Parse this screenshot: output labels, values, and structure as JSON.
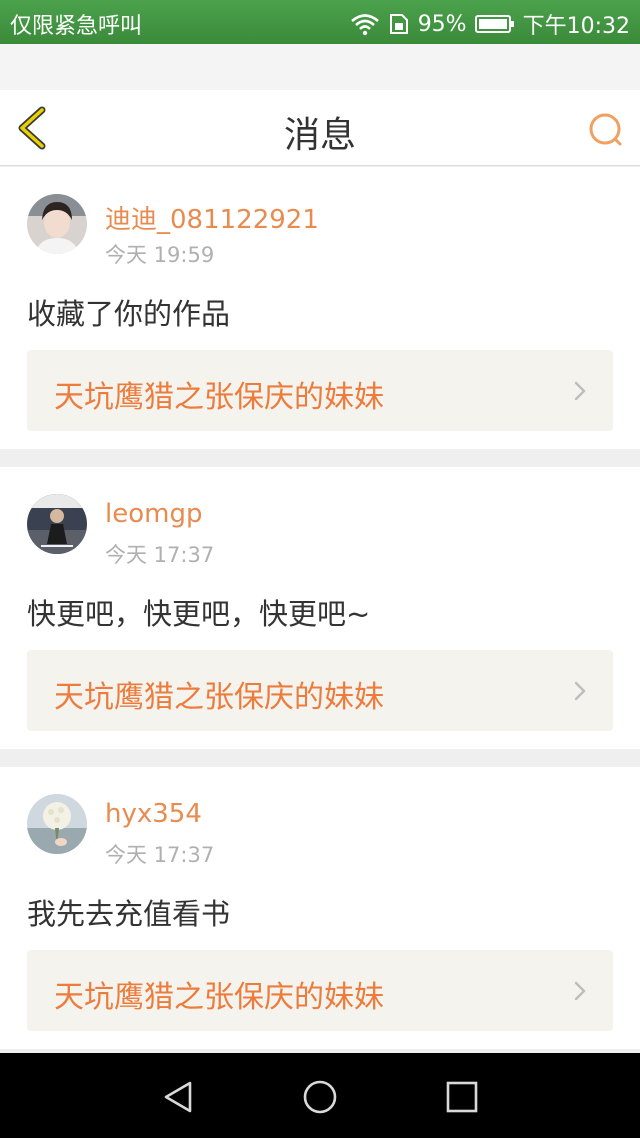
{
  "status_bar": {
    "carrier": "仅限紧急呼叫",
    "battery": "95%",
    "time": "下午10:32"
  },
  "header": {
    "title": "消息",
    "back_icon": "chevron-left-icon",
    "search_icon": "search-icon"
  },
  "colors": {
    "accent": "#e88b4f",
    "work_title": "#ed7c3c",
    "status_bar": "#4ca24c",
    "back_icon": "#e8d100"
  },
  "messages": [
    {
      "username": "迪迪_081122921",
      "time": "今天 19:59",
      "comment": "收藏了你的作品",
      "work_title": "天坑鹰猎之张保庆的妹妹"
    },
    {
      "username": "leomgp",
      "time": "今天 17:37",
      "comment": "快更吧，快更吧，快更吧~",
      "work_title": "天坑鹰猎之张保庆的妹妹"
    },
    {
      "username": "hyx354",
      "time": "今天 17:37",
      "comment": "我先去充值看书",
      "work_title": "天坑鹰猎之张保庆的妹妹"
    }
  ]
}
